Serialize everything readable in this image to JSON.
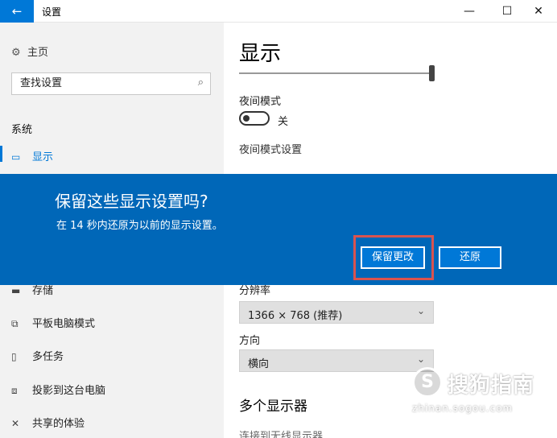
{
  "window": {
    "title": "设置",
    "back_glyph": "←",
    "min_glyph": "—",
    "max_glyph": "☐",
    "close_glyph": "✕"
  },
  "sidebar": {
    "home_label": "主页",
    "home_icon": "gear-icon",
    "search_placeholder": "查找设置",
    "section_title": "系统",
    "items": [
      {
        "label": "显示",
        "icon": "monitor-icon",
        "active": true
      },
      {
        "label": "存储",
        "icon": "storage-icon"
      },
      {
        "label": "平板电脑模式",
        "icon": "tablet-icon"
      },
      {
        "label": "多任务",
        "icon": "multitask-icon"
      },
      {
        "label": "投影到这台电脑",
        "icon": "project-icon"
      },
      {
        "label": "共享的体验",
        "icon": "share-icon"
      }
    ]
  },
  "main": {
    "title": "显示",
    "brightness": 1.0,
    "night_mode_label": "夜间模式",
    "night_mode_state": "关",
    "night_mode_on": false,
    "night_mode_settings": "夜间模式设置",
    "resolution_label": "分辨率",
    "resolution_value": "1366 × 768 (推荐)",
    "orientation_label": "方向",
    "orientation_value": "横向",
    "multi_display_heading": "多个显示器",
    "wireless_link": "连接到无线显示器"
  },
  "dialog": {
    "title": "保留这些显示设置吗?",
    "message": "在 14 秒内还原为以前的显示设置。",
    "keep_button": "保留更改",
    "revert_button": "还原",
    "background_color": "#0067b8",
    "highlight_color": "#d9534f"
  },
  "watermark": {
    "logo_letter": "S",
    "brand": "搜狗指南",
    "url": "zhinan.sogou.com"
  }
}
